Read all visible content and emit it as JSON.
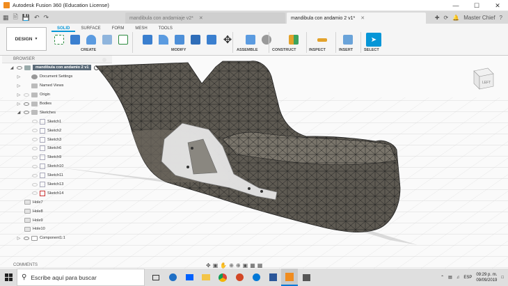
{
  "window": {
    "title": "Autodesk Fusion 360 (Education License)"
  },
  "tabs": [
    {
      "label": "mandibula con andamiaje v2*",
      "active": false
    },
    {
      "label": "mandibula con andamio 2 v1*",
      "active": true
    }
  ],
  "user": "Master Chief",
  "toolbar": {
    "workspace": "DESIGN",
    "ribbon_tabs": [
      "SOLID",
      "SURFACE",
      "FORM",
      "MESH",
      "TOOLS"
    ],
    "groups": [
      "CREATE",
      "MODIFY",
      "ASSEMBLE",
      "CONSTRUCT",
      "INSPECT",
      "INSERT",
      "SELECT"
    ]
  },
  "browser": {
    "header": "BROWSER",
    "root": "mandibula con andamio 2 v1",
    "items": [
      {
        "label": "Document Settings",
        "kind": "settings"
      },
      {
        "label": "Named Views",
        "kind": "folder"
      },
      {
        "label": "Origin",
        "kind": "folder"
      },
      {
        "label": "Bodies",
        "kind": "folder"
      },
      {
        "label": "Sketches",
        "kind": "folder"
      },
      {
        "label": "Sketch1",
        "kind": "sketch"
      },
      {
        "label": "Sketch2",
        "kind": "sketch"
      },
      {
        "label": "Sketch3",
        "kind": "sketch"
      },
      {
        "label": "Sketch6",
        "kind": "sketch"
      },
      {
        "label": "Sketch9",
        "kind": "sketch"
      },
      {
        "label": "Sketch10",
        "kind": "sketch"
      },
      {
        "label": "Sketch11",
        "kind": "sketch"
      },
      {
        "label": "Sketch13",
        "kind": "sketch"
      },
      {
        "label": "Sketch14",
        "kind": "sketch"
      },
      {
        "label": "Hole7",
        "kind": "hole"
      },
      {
        "label": "Hole8",
        "kind": "hole"
      },
      {
        "label": "Hole9",
        "kind": "hole"
      },
      {
        "label": "Hole10",
        "kind": "hole"
      },
      {
        "label": "Component1:1",
        "kind": "component"
      }
    ]
  },
  "comments": "COMMENTS",
  "viewcube": {
    "face": "LEFT"
  },
  "taskbar": {
    "search_placeholder": "Escribe aquí para buscar",
    "language": "ESP",
    "time": "09:29 p. m.",
    "date": "09/09/2019"
  }
}
